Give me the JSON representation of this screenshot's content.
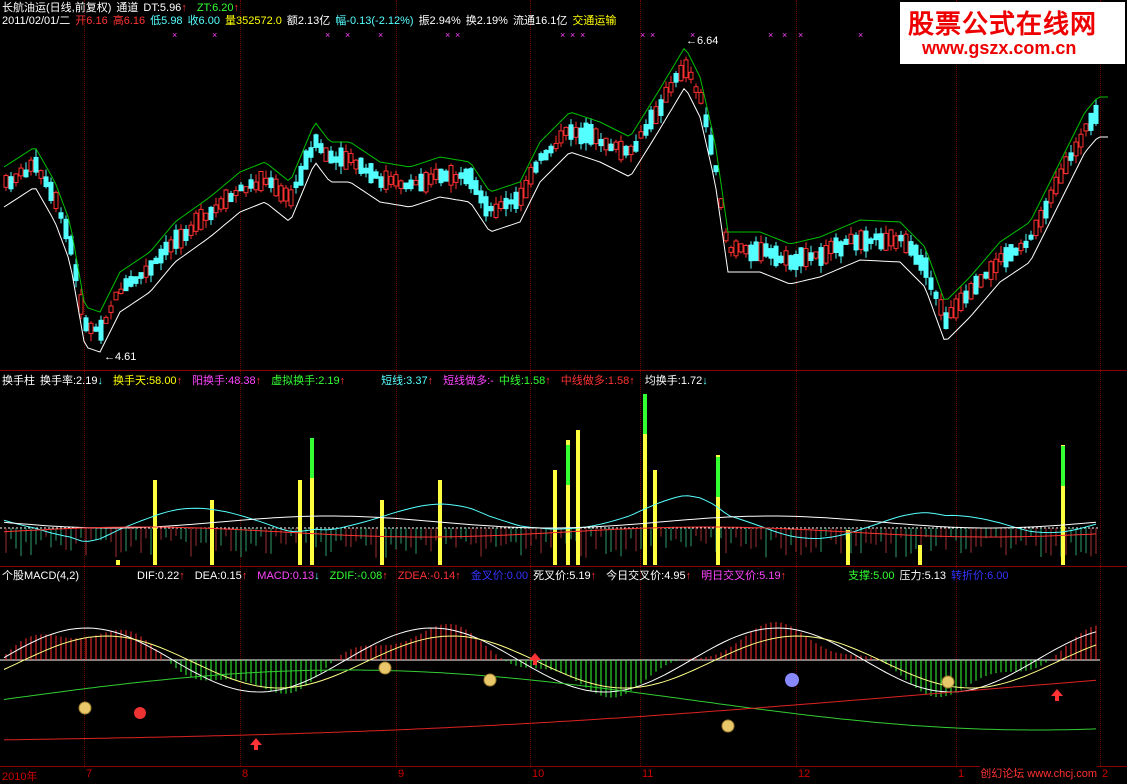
{
  "main": {
    "title": "长航油运(日线,前复权)",
    "indicator": "通道",
    "dt": "DT:5.96",
    "zt": "ZT:6.20",
    "date": "2011/02/01/二",
    "open": "开6.16",
    "high": "高6.16",
    "low": "低5.98",
    "close": "收6.00",
    "volume": "量352572.0",
    "amount": "额2.13亿",
    "change": "幅-0.13(-2.12%)",
    "amplitude": "振2.94%",
    "turnover": "换2.19%",
    "float": "流通16.1亿",
    "sector": "交通运输",
    "high_label": "6.64",
    "low_label": "4.61"
  },
  "turnover_panel": {
    "name": "换手柱",
    "rate": "换手率:2.19",
    "days": "换手天:58.00",
    "yang": "阳换手:48.38",
    "virtual": "虚拟换手:2.19",
    "short": "短线:3.37",
    "short_bull": "短线做多:-",
    "mid": "中线:1.58",
    "mid_bull": "中线做多:1.58",
    "avg": "均换手:1.72"
  },
  "macd_panel": {
    "name": "个股MACD(4,2)",
    "dif": "DIF:0.22",
    "dea": "DEA:0.15",
    "macd": "MACD:0.13",
    "zdif": "ZDIF:-0.08",
    "zdea": "ZDEA:-0.14",
    "golden": "金叉价:0.00",
    "death": "死叉价:5.19",
    "today_cross": "今日交叉价:4.95",
    "tomorrow_cross": "明日交叉价:5.19",
    "support": "支撑:5.00",
    "pressure": "压力:5.13",
    "turn": "转折价:6.00"
  },
  "x_axis": {
    "year": "2010年",
    "months": [
      "7",
      "8",
      "9",
      "10",
      "11",
      "12",
      "1",
      "2"
    ]
  },
  "watermark": {
    "title": "股票公式在线网",
    "url": "www.gszx.com.cn"
  },
  "credit": "创幻论坛 www.chcj.com",
  "colors": {
    "up": "#ff3030",
    "down": "#54ffff",
    "ma_green": "#00c000",
    "ma_white": "#ffffff",
    "yellow": "#ffff40",
    "magenta": "#ff40ff",
    "grid": "#8a0000"
  }
}
